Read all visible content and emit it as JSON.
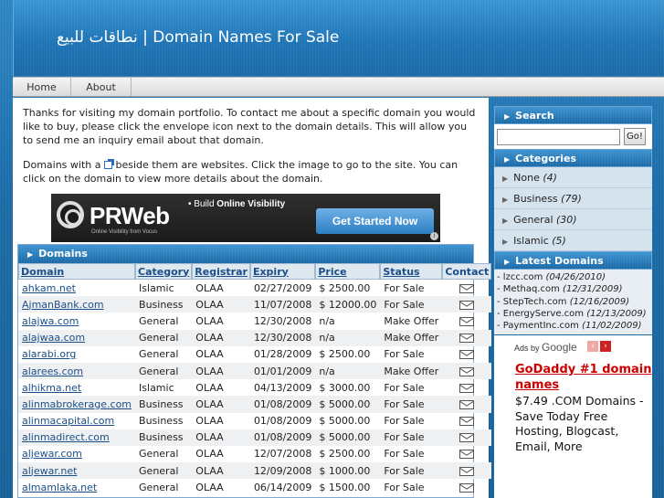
{
  "header": {
    "title": "نطاقات للبيع | Domain Names For Sale"
  },
  "nav": {
    "items": [
      {
        "label": "Home"
      },
      {
        "label": "About"
      }
    ]
  },
  "intro": {
    "paragraph1": "Thanks for visiting my domain portfolio. To contact me about a specific domain you would like to buy, please click the envelope icon next to the domain details. This will allow you to send me an inquiry email about that domain.",
    "paragraph2_before": "Domains with a ",
    "paragraph2_after": " beside them are websites. Click the image to go to the site. You can click on the domain to view more details about the domain."
  },
  "banner": {
    "brand": "PRWeb",
    "tagline": "Online Visibility from Vocus",
    "build_prefix": "• Build ",
    "build_bold": "Online Visibility",
    "cta": "Get Started Now",
    "info": "i"
  },
  "domains": {
    "heading": "Domains",
    "columns": [
      "Domain",
      "Category",
      "Registrar",
      "Expiry",
      "Price",
      "Status",
      "Contact"
    ],
    "rows": [
      {
        "domain": "ahkam.net",
        "category": "Islamic",
        "registrar": "OLAA",
        "expiry": "02/27/2009",
        "price": "$ 2500.00",
        "status": "For Sale"
      },
      {
        "domain": "AjmanBank.com",
        "category": "Business",
        "registrar": "OLAA",
        "expiry": "11/07/2008",
        "price": "$ 12000.00",
        "status": "For Sale"
      },
      {
        "domain": "alajwa.com",
        "category": "General",
        "registrar": "OLAA",
        "expiry": "12/30/2008",
        "price": "n/a",
        "status": "Make Offer"
      },
      {
        "domain": "alajwaa.com",
        "category": "General",
        "registrar": "OLAA",
        "expiry": "12/30/2008",
        "price": "n/a",
        "status": "Make Offer"
      },
      {
        "domain": "alarabi.org",
        "category": "General",
        "registrar": "OLAA",
        "expiry": "01/28/2009",
        "price": "$ 2500.00",
        "status": "For Sale"
      },
      {
        "domain": "alarees.com",
        "category": "General",
        "registrar": "OLAA",
        "expiry": "01/01/2009",
        "price": "n/a",
        "status": "Make Offer"
      },
      {
        "domain": "alhikma.net",
        "category": "Islamic",
        "registrar": "OLAA",
        "expiry": "04/13/2009",
        "price": "$ 3000.00",
        "status": "For Sale"
      },
      {
        "domain": "alinmabrokerage.com",
        "category": "Business",
        "registrar": "OLAA",
        "expiry": "01/08/2009",
        "price": "$ 5000.00",
        "status": "For Sale"
      },
      {
        "domain": "alinmacapital.com",
        "category": "Business",
        "registrar": "OLAA",
        "expiry": "01/08/2009",
        "price": "$ 5000.00",
        "status": "For Sale"
      },
      {
        "domain": "alinmadirect.com",
        "category": "Business",
        "registrar": "OLAA",
        "expiry": "01/08/2009",
        "price": "$ 5000.00",
        "status": "For Sale"
      },
      {
        "domain": "aljewar.com",
        "category": "General",
        "registrar": "OLAA",
        "expiry": "12/07/2008",
        "price": "$ 2500.00",
        "status": "For Sale"
      },
      {
        "domain": "aljewar.net",
        "category": "General",
        "registrar": "OLAA",
        "expiry": "12/09/2008",
        "price": "$ 1000.00",
        "status": "For Sale"
      },
      {
        "domain": "almamlaka.net",
        "category": "General",
        "registrar": "OLAA",
        "expiry": "06/14/2009",
        "price": "$ 1500.00",
        "status": "For Sale"
      }
    ]
  },
  "sidebar": {
    "search": {
      "heading": "Search",
      "placeholder": "",
      "button": "Go!"
    },
    "categories": {
      "heading": "Categories",
      "items": [
        {
          "label": "None",
          "count": "(4)"
        },
        {
          "label": "Business",
          "count": "(79)"
        },
        {
          "label": "General",
          "count": "(30)"
        },
        {
          "label": "Islamic",
          "count": "(5)"
        }
      ]
    },
    "latest": {
      "heading": "Latest Domains",
      "items": [
        {
          "name": "lzcc.com",
          "date": "(04/26/2010)"
        },
        {
          "name": "Methaq.com",
          "date": "(12/31/2009)"
        },
        {
          "name": "StepTech.com",
          "date": "(12/16/2009)"
        },
        {
          "name": "EnergyServe.com",
          "date": "(12/13/2009)"
        },
        {
          "name": "PaymentInc.com",
          "date": "(11/02/2009)"
        }
      ]
    }
  },
  "ads": {
    "ads_by": "Ads by",
    "google": "Google",
    "prev": "‹",
    "next": "›",
    "title": "GoDaddy #1 domain names",
    "text": "$7.49 .COM Domains - Save Today Free Hosting, Blogcast, Email, More"
  }
}
